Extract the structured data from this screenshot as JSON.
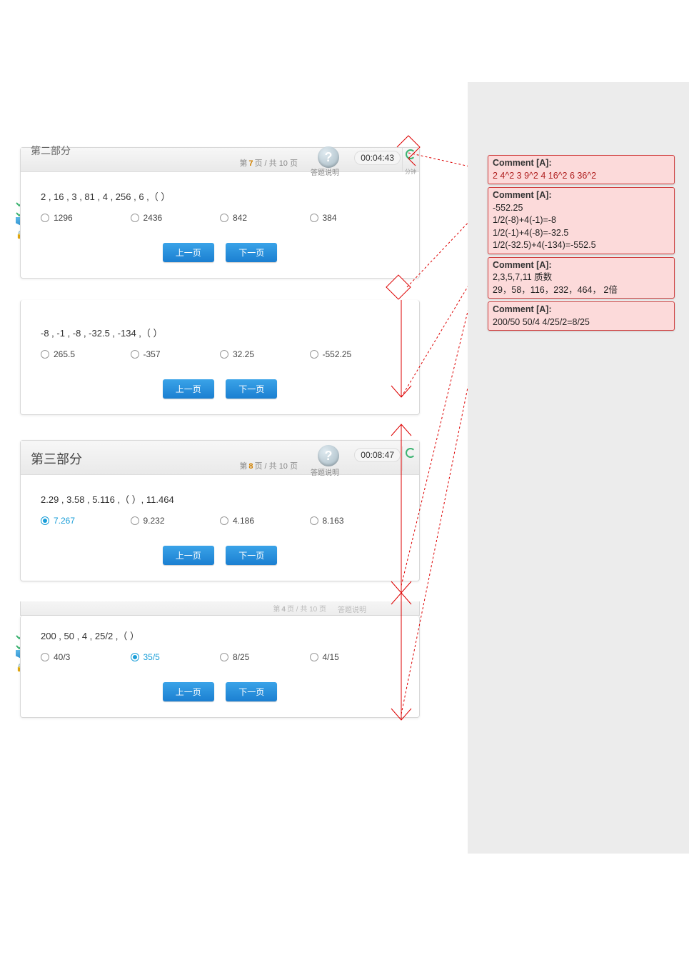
{
  "panels": [
    {
      "title_cut": "第二部分",
      "page_pre": "第",
      "page_cur": "7",
      "page_mid": "页 / 共 10 页",
      "help": "?",
      "help_lbl": "答题说明",
      "timer": "00:04:43",
      "gauge_lbl": "分钟"
    }
  ],
  "q1": {
    "text": "2 , 16 , 3 , 81 , 4 , 256 , 6 ,（ ）",
    "opts": [
      "1296",
      "2436",
      "842",
      "384"
    ]
  },
  "q2": {
    "text": "-8 , -1 , -8 , -32.5 , -134 ,（ ）",
    "opts": [
      "265.5",
      "-357",
      "32.25",
      "-552.25"
    ]
  },
  "hdr2": {
    "title": "第三部分",
    "page_pre": "第",
    "page_cur": "8",
    "page_mid": "页 / 共 10 页",
    "help": "?",
    "help_lbl": "答题说明",
    "timer": "00:08:47"
  },
  "q3": {
    "text": "2.29 , 3.58 , 5.116 ,（ ）, 11.464",
    "opts": [
      "7.267",
      "9.232",
      "4.186",
      "8.163"
    ],
    "selected": 0
  },
  "info": {
    "page_pre": "第",
    "page_cur": "4",
    "page_mid": "页 / 共 10 页",
    "help_lbl": "答题说明"
  },
  "q4": {
    "text": "200 , 50 , 4 , 25/2 ,（ ）",
    "opts": [
      "40/3",
      "35/5",
      "8/25",
      "4/15"
    ],
    "selected": 1
  },
  "btns": {
    "prev": "上一页",
    "next": "下一页"
  },
  "comments": [
    {
      "hdr": "Comment [A]:",
      "body": "2  4^2  3 9^2  4 16^2   6 36^2"
    },
    {
      "hdr": "Comment [A]:",
      "body": "-552.25\n1/2(-8)+4(-1)=-8\n1/2(-1)+4(-8)=-32.5\n1/2(-32.5)+4(-134)=-552.5"
    },
    {
      "hdr": "Comment [A]:",
      "body": "2,3,5,7,11 质数\n29，58，116，232，464， 2倍"
    },
    {
      "hdr": "Comment [A]:",
      "body": "200/50  50/4  4/25/2=8/25"
    }
  ]
}
